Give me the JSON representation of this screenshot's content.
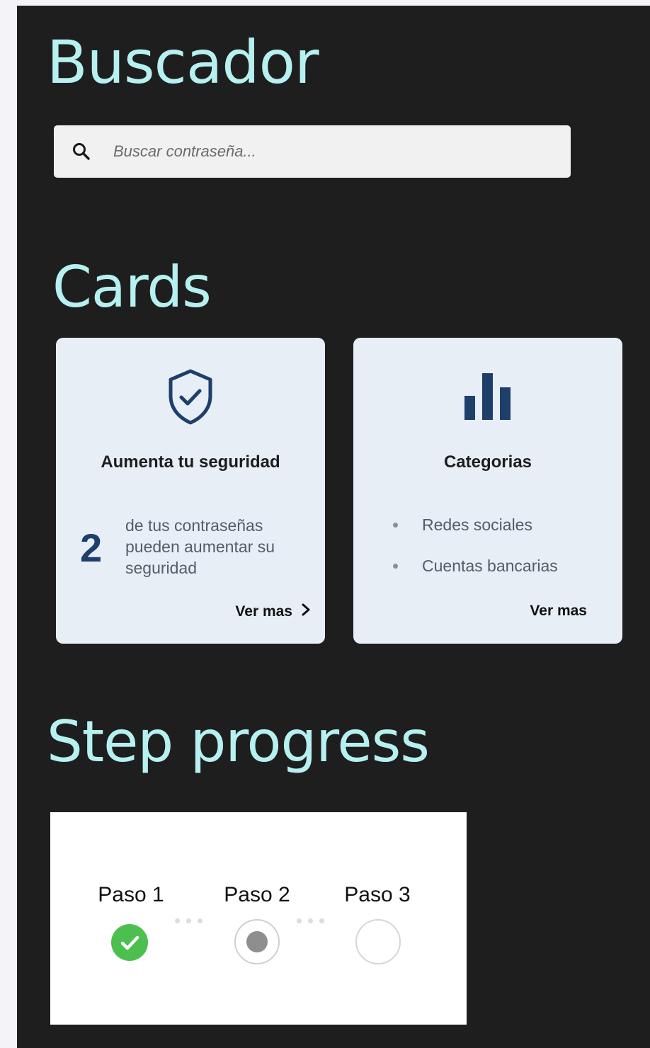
{
  "search_section": {
    "title": "Buscador",
    "placeholder": "Buscar contraseña..."
  },
  "cards_section": {
    "title": "Cards",
    "security_card": {
      "icon": "shield-check-icon",
      "title": "Aumenta tu seguridad",
      "count": "2",
      "description": "de tus contraseñas pueden aumentar su seguridad",
      "link_label": "Ver mas",
      "accent_color": "#1f3f6b"
    },
    "categories_card": {
      "icon": "bar-chart-icon",
      "title": "Categorias",
      "items": [
        "Redes sociales",
        "Cuentas bancarias"
      ],
      "link_label": "Ver mas"
    }
  },
  "steps_section": {
    "title": "Step progress",
    "steps": [
      {
        "label": "Paso 1",
        "status": "completed"
      },
      {
        "label": "Paso 2",
        "status": "current"
      },
      {
        "label": "Paso 3",
        "status": "pending"
      }
    ],
    "completed_color": "#4cc04f"
  },
  "colors": {
    "background": "#1e1e1e",
    "heading": "#b6f0f0",
    "card_background": "#e7eef6"
  }
}
